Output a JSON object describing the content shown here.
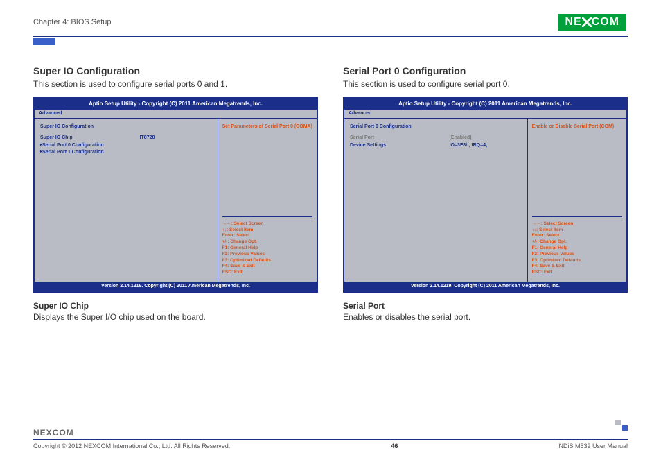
{
  "header": {
    "chapter": "Chapter 4: BIOS Setup",
    "logo_text": "NEXCOM"
  },
  "left": {
    "title": "Super IO Configuration",
    "desc": "This section is used to configure serial ports 0 and 1.",
    "bios": {
      "title": "Aptio Setup Utility - Copyright (C) 2011 American Megatrends, Inc.",
      "tab": "Advanced",
      "heading": "Super IO Configuration",
      "rows": [
        {
          "k": "Super IO Chip",
          "v": "IT8728",
          "link": false
        },
        {
          "k": "Serial Port 0 Configuration",
          "v": "",
          "link": true
        },
        {
          "k": "Serial Port 1 Configuration",
          "v": "",
          "link": true
        }
      ],
      "help": "Set Parameters of Serial Port 0 (COMA)",
      "footer": "Version 2.14.1219. Copyright (C) 2011 American Megatrends, Inc."
    },
    "sub_title": "Super IO Chip",
    "sub_desc": "Displays the Super I/O chip used on the board."
  },
  "right": {
    "title": "Serial Port 0 Configuration",
    "desc": "This section is used to configure serial port 0.",
    "bios": {
      "title": "Aptio Setup Utility - Copyright (C) 2011 American Megatrends, Inc.",
      "tab": "Advanced",
      "heading": "Serial Port 0 Configuration",
      "rows": [
        {
          "k": "Serial Port",
          "v": "[Enabled]",
          "gray": true
        },
        {
          "k": "Device Settings",
          "v": "IO=3F8h; IRQ=4;"
        }
      ],
      "help": "Enable or Disable Serial Port (COM)",
      "footer": "Version 2.14.1219. Copyright (C) 2011 American Megatrends, Inc."
    },
    "sub_title": "Serial Port",
    "sub_desc": "Enables or disables the serial port."
  },
  "nav": {
    "l1": "→←: Select Screen",
    "l2": "↑↓: Select Item",
    "l3": "Enter: Select",
    "l4": "+/-: Change Opt.",
    "l5": "F1: General Help",
    "l6": "F2: Previous Values",
    "l7": "F3: Optimized Defaults",
    "l8": "F4: Save & Exit",
    "l9": "ESC: Exit"
  },
  "footer": {
    "logo": "NEXCOM",
    "copyright": "Copyright © 2012 NEXCOM International Co., Ltd. All Rights Reserved.",
    "page": "46",
    "manual": "NDiS M532 User Manual"
  }
}
